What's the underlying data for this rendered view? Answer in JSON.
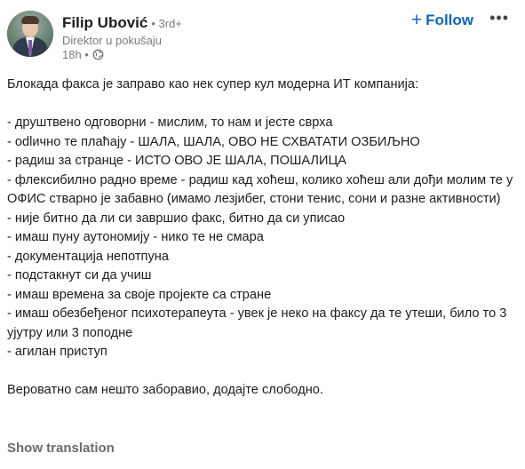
{
  "author": {
    "name": "Filip Ubović",
    "degree": "• 3rd+",
    "title": "Direktor u pokušaju",
    "time": "18h •"
  },
  "actions": {
    "follow_label": "Follow",
    "follow_icon": "plus",
    "more_icon": "ellipsis"
  },
  "post": {
    "intro": "Блокада факса је заправо као нек супер кул модерна ИТ компанија:",
    "items": [
      "- друштвено одговорни - мислим, то нам и јесте сврха",
      "- odlично те плаћају - ШАЛА, ШАЛА, ОВО НЕ СХВАТАТИ ОЗБИЉНО",
      "- радиш за странце - ИСТО ОВО ЈЕ ШАЛА, ПОШАЛИЦА",
      "- флексибилно радно време - радиш кад хоћеш, колико хоћеш али дођи молим те у ОФИС стварно је забавно (имамо лезјибег, стони тенис, сони и разне активности)",
      "- није битно да ли си завршио факс, битно да си уписао",
      "- имаш пуну аутономију - нико те не смара",
      "- документација непотпуна",
      "- подстакнут си да учиш",
      "- имаш времена за своје пројекте са стране",
      "- имаш обезбеђеног психотерапеута - увек је неко на факсу да те утеши, било то 3 ујутру или 3 поподне",
      "- агилан приступ"
    ],
    "outro": "Вероватно сам нешто заборавио, додајте слободно."
  },
  "show_translation_label": "Show translation"
}
